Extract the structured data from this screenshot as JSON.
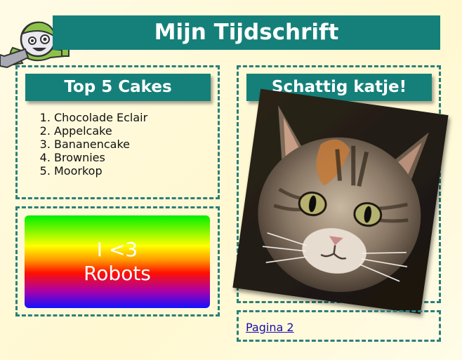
{
  "header": {
    "title": "Mijn Tijdschrift"
  },
  "cakes": {
    "title": "Top 5 Cakes",
    "items": [
      "Chocolade Eclair",
      "Appelcake",
      "Bananencake",
      "Brownies",
      "Moorkop"
    ]
  },
  "robots": {
    "line1": "I <3",
    "line2": "Robots"
  },
  "kitten": {
    "title": "Schattig katje!"
  },
  "footer": {
    "link_label": "Pagina 2"
  }
}
